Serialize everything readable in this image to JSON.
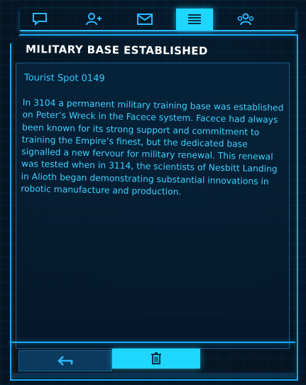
{
  "colors": {
    "accent": "#1fd6ff",
    "frame": "#1aa8f2",
    "text": "#3fd0ff",
    "title": "#ffffff",
    "background": "#06182a"
  },
  "tabs": [
    {
      "icon": "chat-bubble-icon",
      "active": false
    },
    {
      "icon": "friends-icon",
      "active": false
    },
    {
      "icon": "envelope-icon",
      "active": false
    },
    {
      "icon": "list-icon",
      "active": true
    },
    {
      "icon": "group-icon",
      "active": false
    }
  ],
  "message": {
    "title": "MILITARY BASE ESTABLISHED",
    "source": "Tourist Spot 0149",
    "body": "In 3104 a permanent military training base was established on Peter’s Wreck in the Facece system. Facece had always been known for its strong support and commitment to training the Empire’s finest, but the dedicated base signalled a new fervour for military renewal. This renewal was tested when in 3114, the scientists of Nesbitt Landing in Alioth began demonstrating substantial innovations in robotic manufacture and production."
  },
  "footer": {
    "back_icon": "back-arrow-icon",
    "delete_icon": "trash-icon"
  }
}
